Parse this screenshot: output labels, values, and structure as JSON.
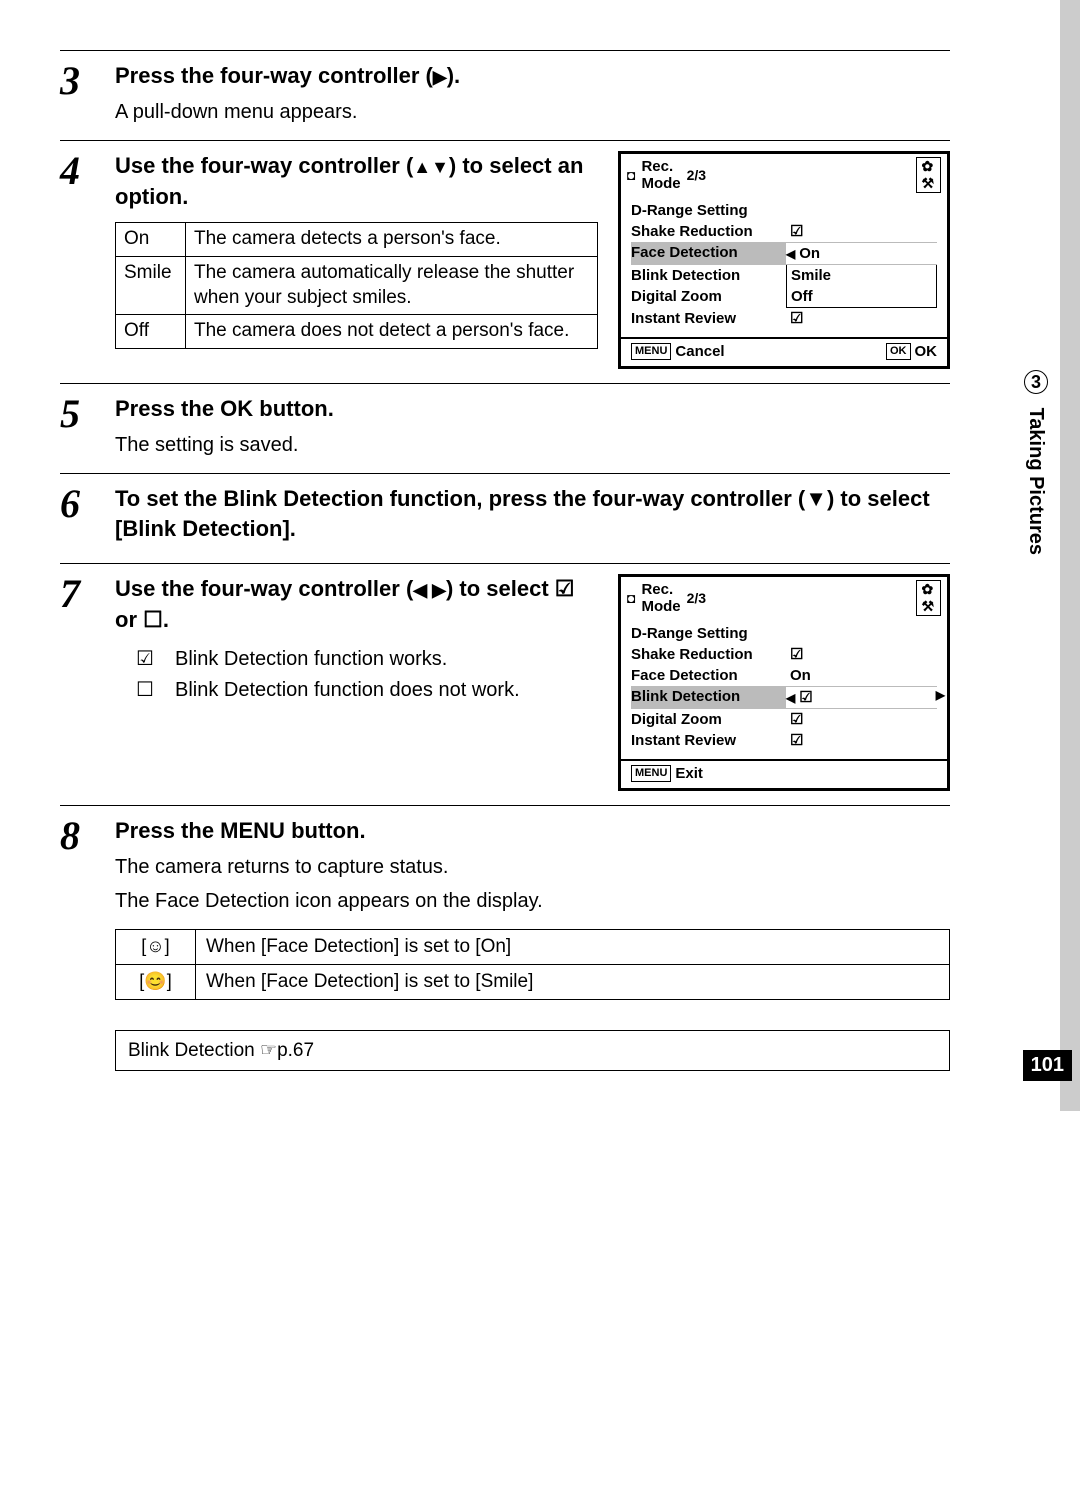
{
  "sideTab": {
    "chapterNum": "3",
    "chapterTitle": "Taking Pictures"
  },
  "pageNum": "101",
  "steps": {
    "s3": {
      "num": "3",
      "title_a": "Press the four-way controller (",
      "title_sym": "▶",
      "title_b": ").",
      "desc": "A pull-down menu appears."
    },
    "s4": {
      "num": "4",
      "title_a": "Use the four-way controller (",
      "title_sym": "▲▼",
      "title_b": ") to select an option.",
      "table": {
        "r1a": "On",
        "r1b": "The camera detects a person's face.",
        "r2a": "Smile",
        "r2b": "The camera automatically release the shutter when your subject smiles.",
        "r3a": "Off",
        "r3b": "The camera does not detect a person's face."
      }
    },
    "s5": {
      "num": "5",
      "title_a": "Press the ",
      "title_ok": "OK",
      "title_b": " button.",
      "desc": "The setting is saved."
    },
    "s6": {
      "num": "6",
      "title": "To set the Blink Detection function, press the four-way controller (▼) to select [Blink Detection]."
    },
    "s7": {
      "num": "7",
      "title_a": "Use the four-way controller (",
      "title_sym": "◀ ▶",
      "title_b": ") to select ",
      "title_sym2a": "☑",
      "title_or": " or ",
      "title_sym2b": "☐",
      "title_c": ".",
      "list": {
        "i1sym": "☑",
        "i1txt": "Blink Detection function works.",
        "i2sym": "☐",
        "i2txt": "Blink Detection function does not work."
      }
    },
    "s8": {
      "num": "8",
      "title_a": "Press the ",
      "title_menu": "MENU",
      "title_b": " button.",
      "desc1": "The camera returns to capture status.",
      "desc2": "The Face Detection icon appears on the display.",
      "iconTable": {
        "r1sym": "⌷☺⌷",
        "r1txt": "When [Face Detection] is set to [On]",
        "r2sym": "⌷😊⌷",
        "r2txt": "When [Face Detection] is set to [Smile]"
      }
    }
  },
  "refBox": {
    "text_a": "Blink Detection ",
    "text_hand": "☞",
    "text_b": "p.67"
  },
  "lcd1": {
    "header": {
      "cam": "◘",
      "title": "Rec. Mode",
      "page": "2/3"
    },
    "rows": {
      "r1l": "D-Range Setting",
      "r1v": "",
      "r2l": "Shake Reduction",
      "r2v": "☑",
      "r3l": "Face Detection",
      "r3v": "On",
      "r4l": "Blink Detection",
      "r4v": "Smile",
      "r5l": "Digital Zoom",
      "r5v": "Off",
      "r6l": "Instant Review",
      "r6v": "☑"
    },
    "footer": {
      "menuLabel": "MENU",
      "cancel": "Cancel",
      "okLabel": "OK",
      "ok": "OK"
    }
  },
  "lcd2": {
    "header": {
      "cam": "◘",
      "title": "Rec. Mode",
      "page": "2/3"
    },
    "rows": {
      "r1l": "D-Range Setting",
      "r1v": "",
      "r2l": "Shake Reduction",
      "r2v": "☑",
      "r3l": "Face Detection",
      "r3v": "On",
      "r4l": "Blink Detection",
      "r4v": "☑",
      "r5l": "Digital Zoom",
      "r5v": "☑",
      "r6l": "Instant Review",
      "r6v": "☑"
    },
    "footer": {
      "menuLabel": "MENU",
      "exit": "Exit"
    }
  }
}
